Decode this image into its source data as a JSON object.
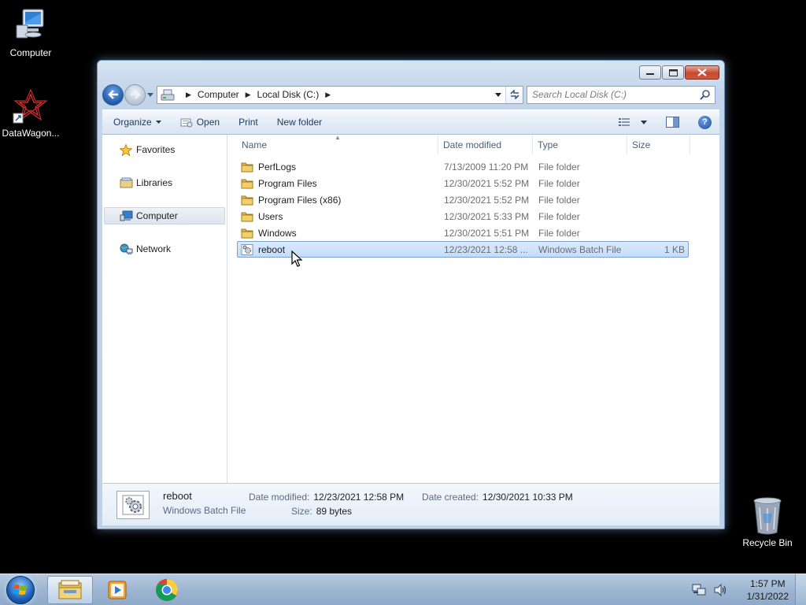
{
  "desktop": {
    "icons": [
      {
        "label": "Computer",
        "icon": "computer-icon"
      },
      {
        "label": "DataWagon...",
        "icon": "datawagon-icon"
      },
      {
        "label": "Recycle Bin",
        "icon": "recycle-bin-icon"
      }
    ]
  },
  "window": {
    "address": {
      "crumbs": [
        "Computer",
        "Local Disk (C:)"
      ]
    },
    "search": {
      "placeholder": "Search Local Disk (C:)"
    },
    "toolbar": {
      "organize": "Organize",
      "open": "Open",
      "print": "Print",
      "new_folder": "New folder"
    },
    "nav_pane": {
      "items": [
        {
          "label": "Favorites",
          "icon": "star-icon",
          "selected": false
        },
        {
          "label": "Libraries",
          "icon": "libraries-icon",
          "selected": false
        },
        {
          "label": "Computer",
          "icon": "computer-icon",
          "selected": true
        },
        {
          "label": "Network",
          "icon": "network-icon",
          "selected": false
        }
      ]
    },
    "columns": {
      "name": "Name",
      "date": "Date modified",
      "type": "Type",
      "size": "Size"
    },
    "files": [
      {
        "name": "PerfLogs",
        "date": "7/13/2009 11:20 PM",
        "type": "File folder",
        "size": "",
        "icon": "folder-icon",
        "selected": false
      },
      {
        "name": "Program Files",
        "date": "12/30/2021 5:52 PM",
        "type": "File folder",
        "size": "",
        "icon": "folder-icon",
        "selected": false
      },
      {
        "name": "Program Files (x86)",
        "date": "12/30/2021 5:52 PM",
        "type": "File folder",
        "size": "",
        "icon": "folder-icon",
        "selected": false
      },
      {
        "name": "Users",
        "date": "12/30/2021 5:33 PM",
        "type": "File folder",
        "size": "",
        "icon": "folder-icon",
        "selected": false
      },
      {
        "name": "Windows",
        "date": "12/30/2021 5:51 PM",
        "type": "File folder",
        "size": "",
        "icon": "folder-icon",
        "selected": false
      },
      {
        "name": "reboot",
        "date": "12/23/2021 12:58 ...",
        "type": "Windows Batch File",
        "size": "1 KB",
        "icon": "batch-file-icon",
        "selected": true
      }
    ],
    "details": {
      "name": "reboot",
      "type": "Windows Batch File",
      "date_modified_label": "Date modified:",
      "date_modified": "12/23/2021 12:58 PM",
      "date_created_label": "Date created:",
      "date_created": "12/30/2021 10:33 PM",
      "size_label": "Size:",
      "size": "89 bytes"
    }
  },
  "taskbar": {
    "apps": [
      "file-explorer-icon",
      "media-player-icon",
      "chrome-icon"
    ],
    "clock": {
      "time": "1:57 PM",
      "date": "1/31/2022"
    }
  },
  "colors": {
    "selection": "#c2dcfc",
    "selection_border": "#7da2ce",
    "window_frame": "#c4d5ea",
    "close_button": "#c7482d"
  }
}
